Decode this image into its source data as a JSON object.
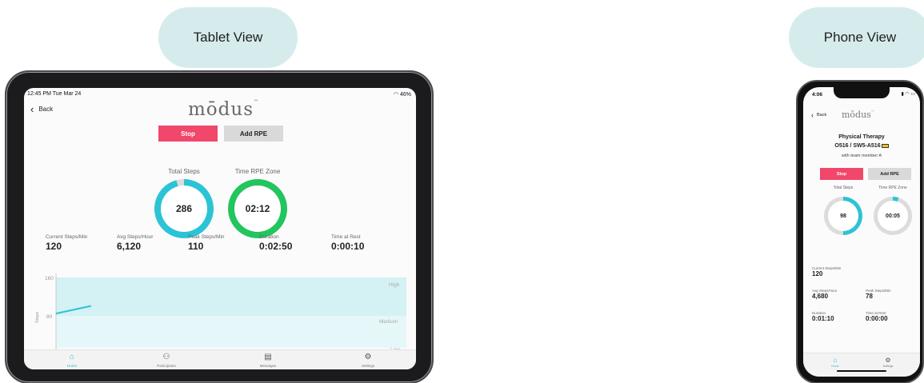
{
  "labels": {
    "tablet_view": "Tablet View",
    "phone_view": "Phone View"
  },
  "tablet": {
    "status": {
      "time": "12:45 PM  Tue Mar 24",
      "battery": "46%"
    },
    "back_label": "Back",
    "logo": "mōdus",
    "stop_label": "Stop",
    "add_rpe_label": "Add RPE",
    "total_steps_label": "Total Steps",
    "total_steps_value": "286",
    "total_steps_fraction": 0.96,
    "time_rpe_label": "Time RPE Zone",
    "time_rpe_value": "02:12",
    "time_rpe_fraction": 1.0,
    "stats": [
      {
        "label": "Current Steps/Min",
        "value": "120"
      },
      {
        "label": "Avg Steps/Hour",
        "value": "6,120"
      },
      {
        "label": "Peak Steps/Min",
        "value": "110"
      },
      {
        "label": "Duration",
        "value": "0:02:50"
      },
      {
        "label": "Time at Rest",
        "value": "0:00:10"
      }
    ],
    "tabs": [
      {
        "label": "Home",
        "icon": "home-icon",
        "active": true
      },
      {
        "label": "Participants",
        "icon": "participants-icon",
        "active": false
      },
      {
        "label": "Messages",
        "icon": "messages-icon",
        "active": false
      },
      {
        "label": "Settings",
        "icon": "gear-icon",
        "active": false
      }
    ]
  },
  "chart_data": {
    "type": "line",
    "ylabel": "Steps",
    "yticks": [
      "160",
      "80"
    ],
    "ylim": [
      0,
      160
    ],
    "zones": [
      "High",
      "Medium",
      "Low"
    ],
    "zone_color": "#d4f1f4",
    "series": [
      {
        "values": [
          {
            "x": 0,
            "y": 84
          },
          {
            "x": 1,
            "y": 100
          }
        ]
      }
    ],
    "xlim": [
      0,
      10
    ]
  },
  "phone": {
    "time": "4:06",
    "back_label": "Back",
    "logo": "mōdus",
    "title": "Physical Therapy",
    "device_id": "O516 / SW5-A516",
    "team_member": "with team member A",
    "stop_label": "Stop",
    "add_rpe_label": "Add RPE",
    "total_steps_label": "Total Steps",
    "total_steps_value": "98",
    "total_steps_fraction": 0.5,
    "time_rpe_label": "Time RPE Zone",
    "time_rpe_value": "00:05",
    "time_rpe_fraction": 0.05,
    "current_steps_label": "Current Steps/Min",
    "current_steps_value": "120",
    "avg_steps_label": "Avg Steps/Hour",
    "avg_steps_value": "4,680",
    "peak_steps_label": "Peak Steps/Min",
    "peak_steps_value": "78",
    "duration_label": "Duration",
    "duration_value": "0:01:10",
    "rest_label": "Time at Rest",
    "rest_value": "0:00:00",
    "tabs": [
      {
        "label": "Home",
        "icon": "home-icon",
        "active": true
      },
      {
        "label": "Settings",
        "icon": "gear-icon",
        "active": false
      }
    ]
  }
}
